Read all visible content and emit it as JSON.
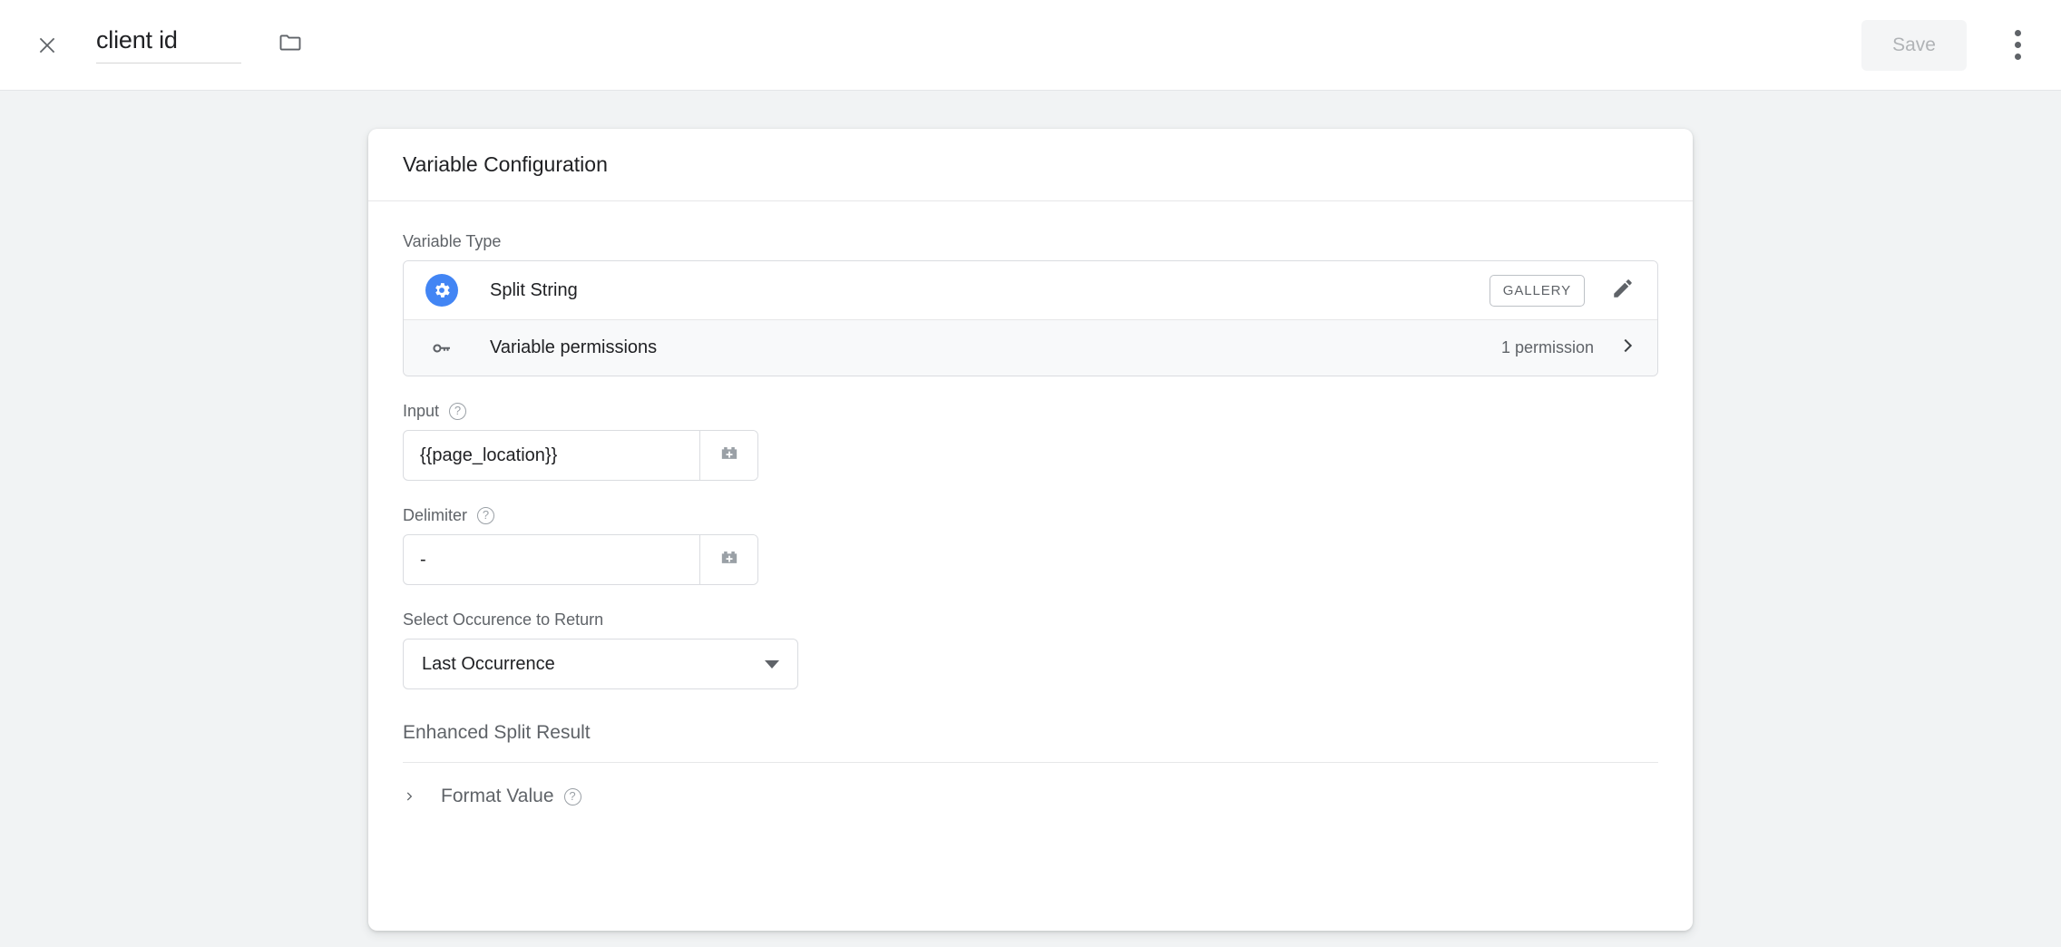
{
  "topbar": {
    "close_icon": "close-icon",
    "title_value": "client id",
    "title_placeholder": "Untitled Variable",
    "folder_icon": "folder-icon",
    "save_label": "Save",
    "menu_icon": "more-vert-icon"
  },
  "card": {
    "header_title": "Variable Configuration",
    "variable_type": {
      "label": "Variable Type",
      "icon": "gear-icon",
      "icon_color": "#4285f4",
      "name": "Split String",
      "gallery_badge": "GALLERY",
      "edit_icon": "pencil-icon"
    },
    "permissions": {
      "icon": "key-icon",
      "label": "Variable permissions",
      "count": "1 permission",
      "chevron_icon": "chevron-right-icon"
    },
    "input_field": {
      "label": "Input",
      "help_icon": "help-circle-icon",
      "value": "{{page_location}}",
      "placeholder": "",
      "picker_icon": "variable-picker-icon"
    },
    "delimiter_field": {
      "label": "Delimiter",
      "help_icon": "help-circle-icon",
      "value": "-",
      "placeholder": "",
      "picker_icon": "variable-picker-icon"
    },
    "occurrence_field": {
      "label": "Select Occurence to Return",
      "selected": "Last Occurrence",
      "caret_icon": "caret-down-icon"
    },
    "enhanced_section": {
      "title": "Enhanced Split Result"
    },
    "format_value": {
      "chevron_icon": "chevron-right-icon",
      "label": "Format Value",
      "help_icon": "help-circle-icon"
    }
  }
}
